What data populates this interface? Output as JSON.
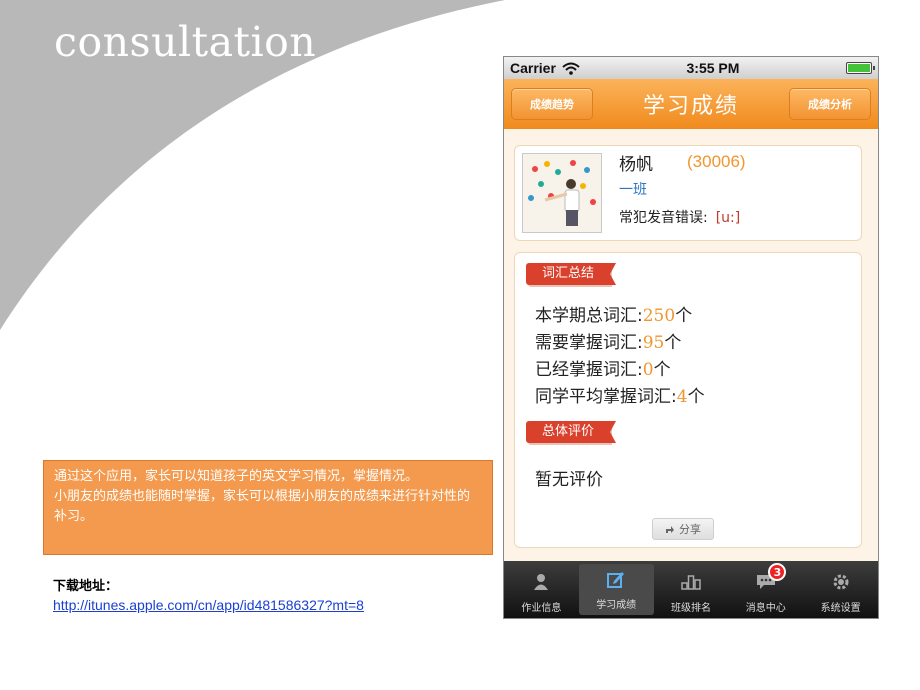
{
  "slide": {
    "title": "consultation",
    "description_lines": [
      "通过这个应用，家长可以知道孩子的英文学习情况，掌握情况。",
      "小朋友的成绩也能随时掌握，家长可以根据小朋友的成绩来进行针对性的补习。"
    ],
    "download_label": "下载地址：",
    "download_url": "http://itunes.apple.com/cn/app/id481586327?mt=8"
  },
  "phone": {
    "status": {
      "carrier": "Carrier",
      "time": "3:55 PM"
    },
    "nav": {
      "left_button": "成绩趋势",
      "title": "学习成绩",
      "right_button": "成绩分析"
    },
    "profile": {
      "name": "杨帆",
      "id": "(30006)",
      "class": "一班",
      "error_label": "常犯发音错误:",
      "error_value": "[u:]"
    },
    "vocab_section": {
      "ribbon": "词汇总结",
      "stats": [
        {
          "label": "本学期总词汇:",
          "num": "250",
          "unit": "个"
        },
        {
          "label": "需要掌握词汇:",
          "num": "95",
          "unit": "个"
        },
        {
          "label": "已经掌握词汇:",
          "num": "0",
          "unit": "个"
        },
        {
          "label": "同学平均掌握词汇:",
          "num": "4",
          "unit": "个"
        }
      ]
    },
    "eval_section": {
      "ribbon": "总体评价",
      "text": "暂无评价",
      "share": "分享"
    },
    "tabs": [
      {
        "label": "作业信息",
        "icon": "person-icon"
      },
      {
        "label": "学习成绩",
        "icon": "edit-icon"
      },
      {
        "label": "班级排名",
        "icon": "ranking-icon"
      },
      {
        "label": "消息中心",
        "icon": "message-icon",
        "badge": "3"
      },
      {
        "label": "系统设置",
        "icon": "gear-icon"
      }
    ],
    "active_tab": 1
  },
  "colors": {
    "accent": "#f08a1d",
    "ribbon": "#d9412c",
    "highlight": "#f0962e",
    "link": "#1a3fd1"
  }
}
